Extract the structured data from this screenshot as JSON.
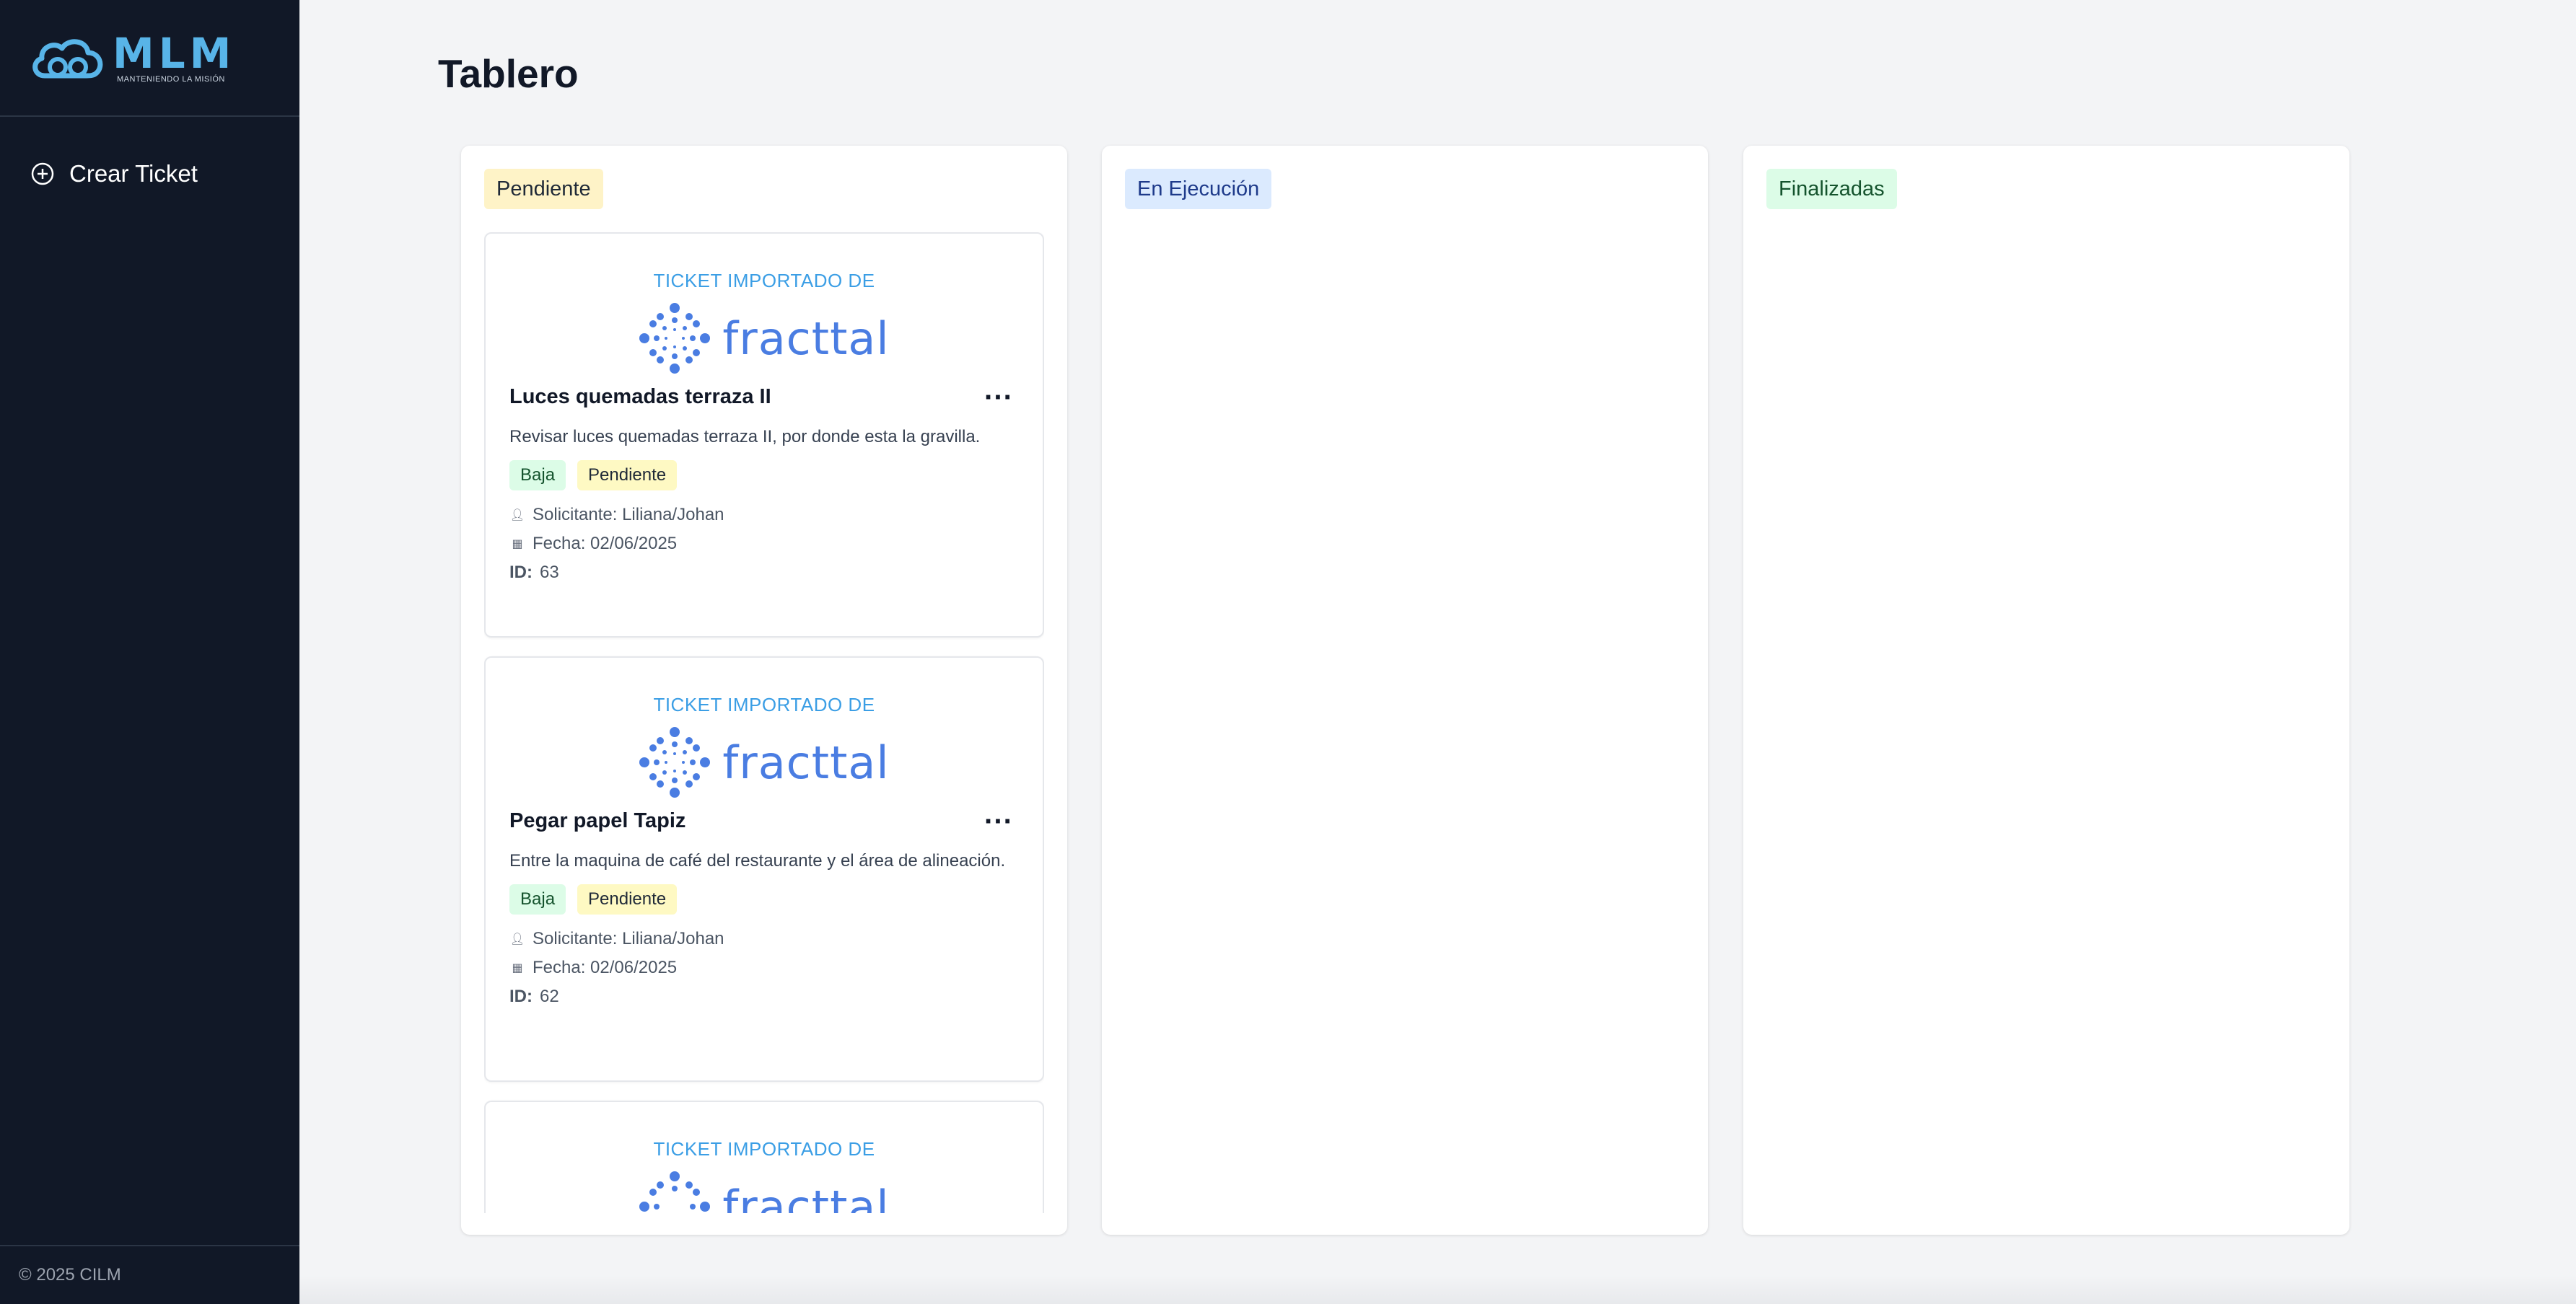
{
  "sidebar": {
    "logo": {
      "main": "MLM",
      "sub": "Manteniendo la Misión"
    },
    "nav": [
      {
        "label": "Crear Ticket",
        "icon": "plus-circle-icon"
      }
    ],
    "footer": "© 2025 CILM"
  },
  "page": {
    "title": "Tablero"
  },
  "columns": [
    {
      "label": "Pendiente",
      "color": "#fef3c7",
      "cards": [
        {
          "banner": "TICKET IMPORTADO DE",
          "brand": "fracttal",
          "title": "Luces quemadas terraza II",
          "description": "Revisar luces quemadas terraza II, por donde esta la gravilla.",
          "priority": "Baja",
          "status": "Pendiente",
          "requester": "Solicitante: Liliana/Johan",
          "date": "Fecha: 02/06/2025",
          "id_label": "ID:",
          "id": "63"
        },
        {
          "banner": "TICKET IMPORTADO DE",
          "brand": "fracttal",
          "title": "Pegar papel Tapiz",
          "description": "Entre la maquina de café del restaurante y el área de alineación.",
          "priority": "Baja",
          "status": "Pendiente",
          "requester": "Solicitante: Liliana/Johan",
          "date": "Fecha: 02/06/2025",
          "id_label": "ID:",
          "id": "62"
        },
        {
          "banner": "TICKET IMPORTADO DE",
          "brand": "fracttal"
        }
      ]
    },
    {
      "label": "En Ejecución",
      "color": "#dbeafe",
      "cards": []
    },
    {
      "label": "Finalizadas",
      "color": "#dcfce7",
      "cards": []
    }
  ]
}
